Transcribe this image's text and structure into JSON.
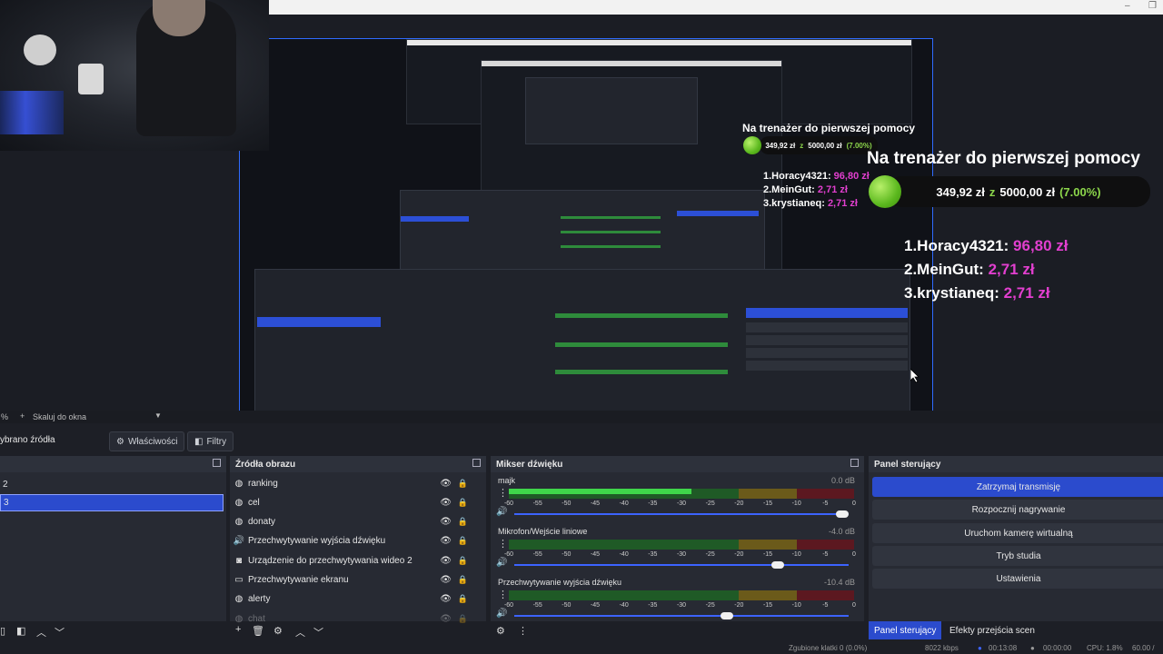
{
  "window_controls": {
    "minimize": "–",
    "restore": "❐"
  },
  "preview": {
    "donation": {
      "title": "Na trenażer do pierwszej pomocy",
      "amount": "349,92 zł",
      "of": "z",
      "goal": "5000,00 zł",
      "percent": "(7.00%)",
      "progress": 0.07,
      "ranking": [
        {
          "label": "1.Horacy4321:",
          "amount": "96,80 zł"
        },
        {
          "label": "2.MeinGut:",
          "amount": "2,71 zł"
        },
        {
          "label": "3.krystianeq:",
          "amount": "2,71 zł"
        }
      ]
    }
  },
  "scale": {
    "percent_suffix": "%",
    "mode": "Skaluj do okna"
  },
  "source_toolbar": {
    "selected_label": "ybrano źródła",
    "properties": "Właściwości",
    "filters": "Filtry"
  },
  "scenes": {
    "items": [
      "2",
      "3"
    ],
    "selected": "3"
  },
  "sources": {
    "title": "Źródła obrazu",
    "items": [
      {
        "name": "ranking",
        "icon": "globe-icon"
      },
      {
        "name": "cel",
        "icon": "globe-icon"
      },
      {
        "name": "donaty",
        "icon": "globe-icon"
      },
      {
        "name": "Przechwytywanie wyjścia dźwięku",
        "icon": "speaker-icon"
      },
      {
        "name": "Urządzenie do przechwytywania wideo 2",
        "icon": "camera-icon"
      },
      {
        "name": "Przechwytywanie ekranu",
        "icon": "monitor-icon"
      },
      {
        "name": "alerty",
        "icon": "globe-icon"
      },
      {
        "name": "chat",
        "icon": "globe-icon"
      }
    ]
  },
  "mixer": {
    "title": "Mikser dźwięku",
    "tick_labels": [
      "-60",
      "-55",
      "-50",
      "-45",
      "-40",
      "-35",
      "-30",
      "-25",
      "-20",
      "-15",
      "-10",
      "-5",
      "0"
    ],
    "channels": [
      {
        "name": "majk",
        "db": "0.0 dB",
        "level": 0.53,
        "volume": 1.0
      },
      {
        "name": "Mikrofon/Wejście liniowe",
        "db": "-4.0 dB",
        "level": 0.0,
        "volume": 0.8
      },
      {
        "name": "Przechwytywanie wyjścia dźwięku",
        "db": "-10.4 dB",
        "level": 0.0,
        "volume": 0.64
      }
    ]
  },
  "controls": {
    "title": "Panel sterujący",
    "buttons": [
      "Zatrzymaj transmisję",
      "Rozpocznij nagrywanie",
      "Uruchom kamerę wirtualną",
      "Tryb studia",
      "Ustawienia"
    ]
  },
  "tabs": {
    "panel": "Panel sterujący",
    "effects": "Efekty przejścia scen"
  },
  "status": {
    "dropped": "Zgubione klatki 0 (0.0%)",
    "bitrate": "8022 kbps",
    "live": "00:13:08",
    "rec": "00:00:00",
    "cpu": "CPU: 1.8%",
    "fps": "60.00 /"
  },
  "colors": {
    "accent": "#2b4bcd",
    "green_text": "#8cd64b",
    "magenta_text": "#e23fcf"
  }
}
